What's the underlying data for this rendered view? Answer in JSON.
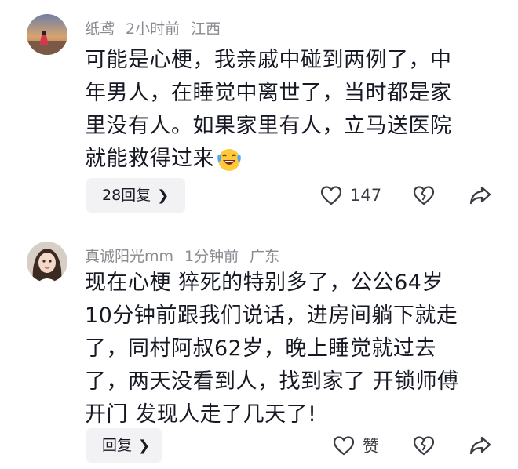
{
  "comments": [
    {
      "username": "纸鸢",
      "time": "2小时前",
      "location": "江西",
      "lines": [
        "可能是心梗，我亲戚中碰到两例了，中",
        "年男人，在睡觉中离世了，当时都是家",
        "里没有人。如果家里有人，立马送医院",
        "就能救得过来"
      ],
      "emoji_icon": "laughing-crying-emoji-icon",
      "reply_label": "28回复",
      "like_count": "147"
    },
    {
      "username": "真诚阳光mm",
      "time": "1分钟前",
      "location": "广东",
      "lines": [
        "现在心梗 猝死的特别多了，公公64岁",
        "10分钟前跟我们说话，进房间躺下就走",
        "了，同村阿叔62岁，晚上睡觉就过去",
        "了，两天没看到人，找到家了 开锁师傅",
        "开门 发现人走了几天了!"
      ],
      "reply_label": "回复",
      "like_label": "赞"
    }
  ],
  "icons": {
    "chevron": "chevron-right-icon",
    "like": "heart-outline-icon",
    "dislike": "broken-heart-icon",
    "share": "share-arrow-icon"
  },
  "colors": {
    "text": "#161823",
    "meta": "#8a8b91",
    "reply_bg": "#f2f2f4",
    "icon": "#3b3c43"
  }
}
